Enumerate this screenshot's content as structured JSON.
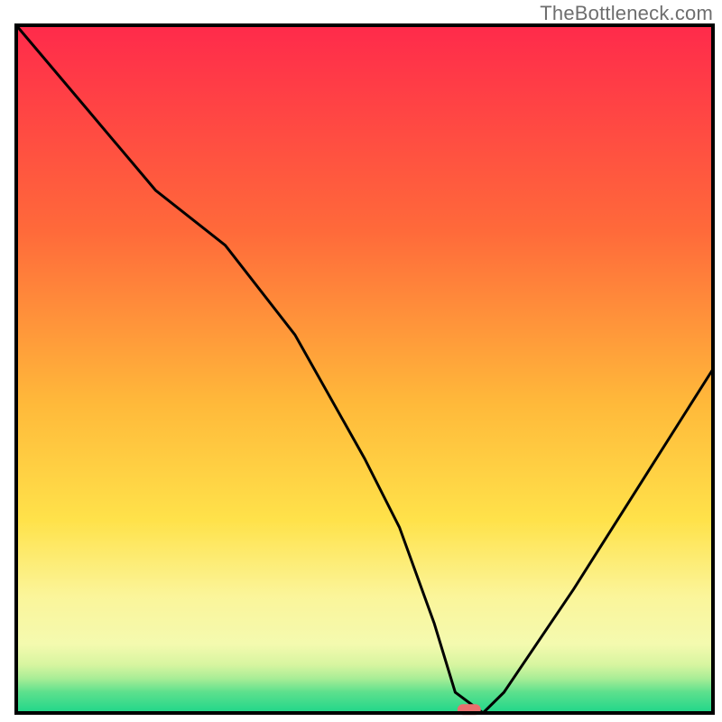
{
  "watermark": "TheBottleneck.com",
  "accent_marker_color": "#e96f6e",
  "curve_color": "#000000",
  "border_color": "#000000",
  "chart_data": {
    "type": "line",
    "title": "",
    "xlabel": "",
    "ylabel": "",
    "xlim": [
      0,
      100
    ],
    "ylim": [
      0,
      100
    ],
    "series": [
      {
        "name": "curve",
        "x": [
          0,
          10,
          20,
          30,
          40,
          50,
          55,
          60,
          63,
          67,
          70,
          80,
          90,
          100
        ],
        "y": [
          100,
          88,
          76,
          68,
          55,
          37,
          27,
          13,
          3,
          0,
          3,
          18,
          34,
          50
        ]
      }
    ],
    "marker": {
      "x": 65,
      "y": 0.5
    },
    "gradient_stops": [
      {
        "offset": 0,
        "color": "#ff2a4b"
      },
      {
        "offset": 30,
        "color": "#ff6a3a"
      },
      {
        "offset": 55,
        "color": "#ffb93a"
      },
      {
        "offset": 72,
        "color": "#ffe24a"
      },
      {
        "offset": 83,
        "color": "#fbf59a"
      },
      {
        "offset": 90,
        "color": "#f4faaf"
      },
      {
        "offset": 93,
        "color": "#d7f5a0"
      },
      {
        "offset": 95,
        "color": "#a8ed96"
      },
      {
        "offset": 97,
        "color": "#5ce08d"
      },
      {
        "offset": 100,
        "color": "#1fd68a"
      }
    ]
  }
}
